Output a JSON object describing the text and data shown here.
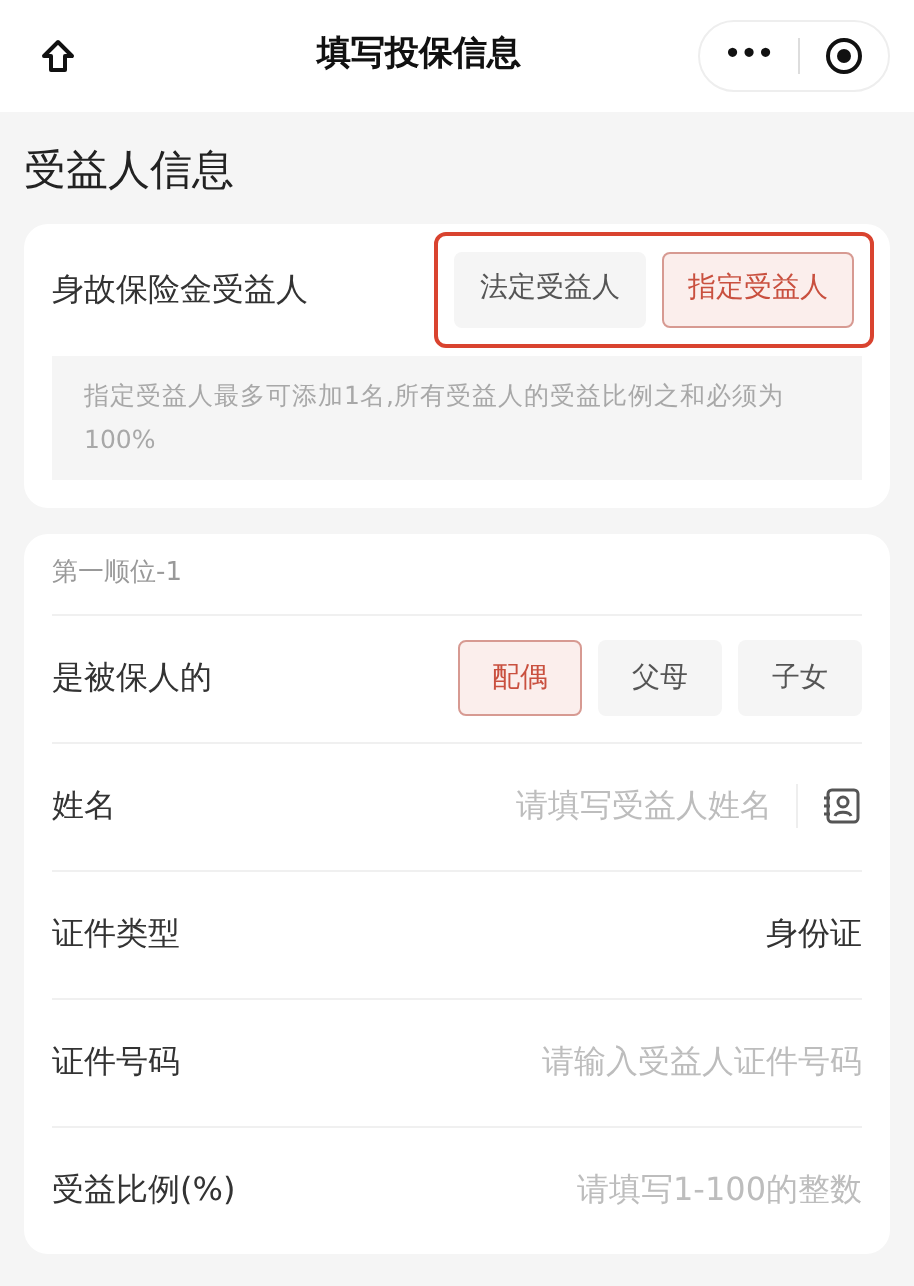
{
  "nav": {
    "title": "填写投保信息",
    "more": "•••"
  },
  "section_title": "受益人信息",
  "beneficiary_type": {
    "label": "身故保险金受益人",
    "highlighted": true,
    "options": [
      {
        "label": "法定受益人",
        "selected": false
      },
      {
        "label": "指定受益人",
        "selected": true
      }
    ],
    "note": "指定受益人最多可添加1名,所有受益人的受益比例之和必须为100%"
  },
  "beneficiary": {
    "heading": "第一顺位-1",
    "rows": [
      {
        "kind": "options",
        "label": "是被保人的",
        "options": [
          {
            "label": "配偶",
            "selected": true
          },
          {
            "label": "父母",
            "selected": false
          },
          {
            "label": "子女",
            "selected": false
          }
        ]
      },
      {
        "kind": "input",
        "label": "姓名",
        "placeholder": "请填写受益人姓名",
        "contact_picker": true
      },
      {
        "kind": "value",
        "label": "证件类型",
        "value": "身份证"
      },
      {
        "kind": "input",
        "label": "证件号码",
        "placeholder": "请输入受益人证件号码",
        "contact_picker": false
      },
      {
        "kind": "input",
        "label": "受益比例(%)",
        "placeholder": "请填写1-100的整数",
        "contact_picker": false
      }
    ]
  }
}
